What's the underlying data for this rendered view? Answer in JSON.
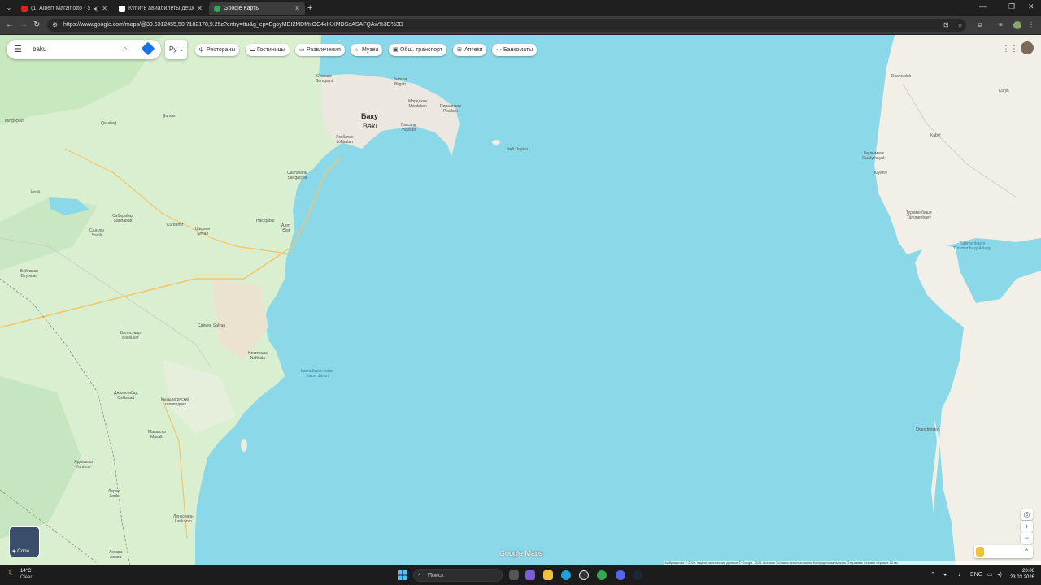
{
  "browser": {
    "tabs": [
      {
        "title": "(1) Albert Marzinotto - Sali",
        "favicon_color": "#e02020",
        "audio": true
      },
      {
        "title": "Купить авиабилеты дешево о",
        "favicon_color": "#ffffff"
      },
      {
        "title": "Google Карты",
        "favicon_color": "#34a853"
      }
    ],
    "url": "https://www.google.com/maps/@39.6312455,50.7182178,9.25z?entry=ttu&g_ep=EgoyMDI2MDMxOC4xIKXMDSoASAFQAw%3D%3D"
  },
  "maps": {
    "search_value": "baku",
    "language_button": "Ру",
    "chips": [
      {
        "label": "Рестораны",
        "icon": "utensils-icon"
      },
      {
        "label": "Гостиницы",
        "icon": "bed-icon"
      },
      {
        "label": "Развлечения",
        "icon": "ticket-icon"
      },
      {
        "label": "Музеи",
        "icon": "museum-icon"
      },
      {
        "label": "Общ. транспорт",
        "icon": "bus-icon"
      },
      {
        "label": "Аптеки",
        "icon": "pharmacy-icon"
      },
      {
        "label": "Банкоматы",
        "icon": "atm-icon"
      }
    ],
    "layers_label": "Слои",
    "logo": "Google Maps",
    "attribution": "Изображения © 2026, Картографические данные © Google, 2026   Условия   Условия использования   Конфиденциальность   Отправить отзыв о сервисе   20 км",
    "labels": {
      "baku_ru": "Баку",
      "baku_az": "Bakı",
      "sumgait": "Сумгаит\nSumqayıt",
      "neft_dashlari": "Neft Daşları",
      "caspian": "Каспийское море\nXəzər dənizi",
      "turkmenbashi_bay": "Turkmenbashi\nTürkmenbaşy Aylagy",
      "turkmenbashi": "Туркменбаши\nTürkmenbaşy",
      "kuryk": "Kuryk",
      "dashruduk": "Dashruduk",
      "kabyl": "Kabyl",
      "guwlymayak": "Гаулымаяк\nGuwlymayak",
      "kiyanly": "Kiyanly",
      "ogurchinsky": "Ogurchinsky",
      "lenkoran": "Ленкорань\nLənkəran",
      "shirvan": "Ширван\nŞirvan",
      "salyan": "Сальян\nSalyan",
      "alat": "Алят\nƏlət",
      "neftchala": "Нефтчала\nNeftçala",
      "masalli": "Масаллы\nMasallı",
      "jalilabad": "Джалилабад\nCəlilabad",
      "bilasuvar": "Билясувар\nBiləsuvar",
      "kurdamir": "Kürdəmir",
      "shamakhi": "Şamaxı",
      "qusar": "Qarabağ",
      "sangachal": "Сангачаль\nSangachal",
      "yardimli": "Ярдымлы\nYardımlı",
      "lerik": "Лерик\nLerik",
      "astara": "Астара\nAstara",
      "qazimammad": "Hacıqabul",
      "mingachevir": "Mingəçevir",
      "saatli": "Саатлы\nSaatlı",
      "sabirabad": "Сабирабад\nSabirabad",
      "beylagan": "Бейлаган\nBeyləqan",
      "imishli": "İmişli",
      "kyzylagach": "Кызылагачский\nзаповедник",
      "lokbatan": "Локбатан\nLökbatan",
      "hovsan": "Говсаны\nHövsan",
      "pirallahi": "Пираллахи\nPirallahı",
      "mardakan": "Мардакан\nMərdəkan",
      "bilgah": "Бильгя\nBilgəh"
    }
  },
  "taskbar": {
    "temperature": "14°C",
    "condition": "Clear",
    "search_placeholder": "Поиск",
    "language": "ENG",
    "time": "20:06",
    "date": "23.03.2026"
  }
}
